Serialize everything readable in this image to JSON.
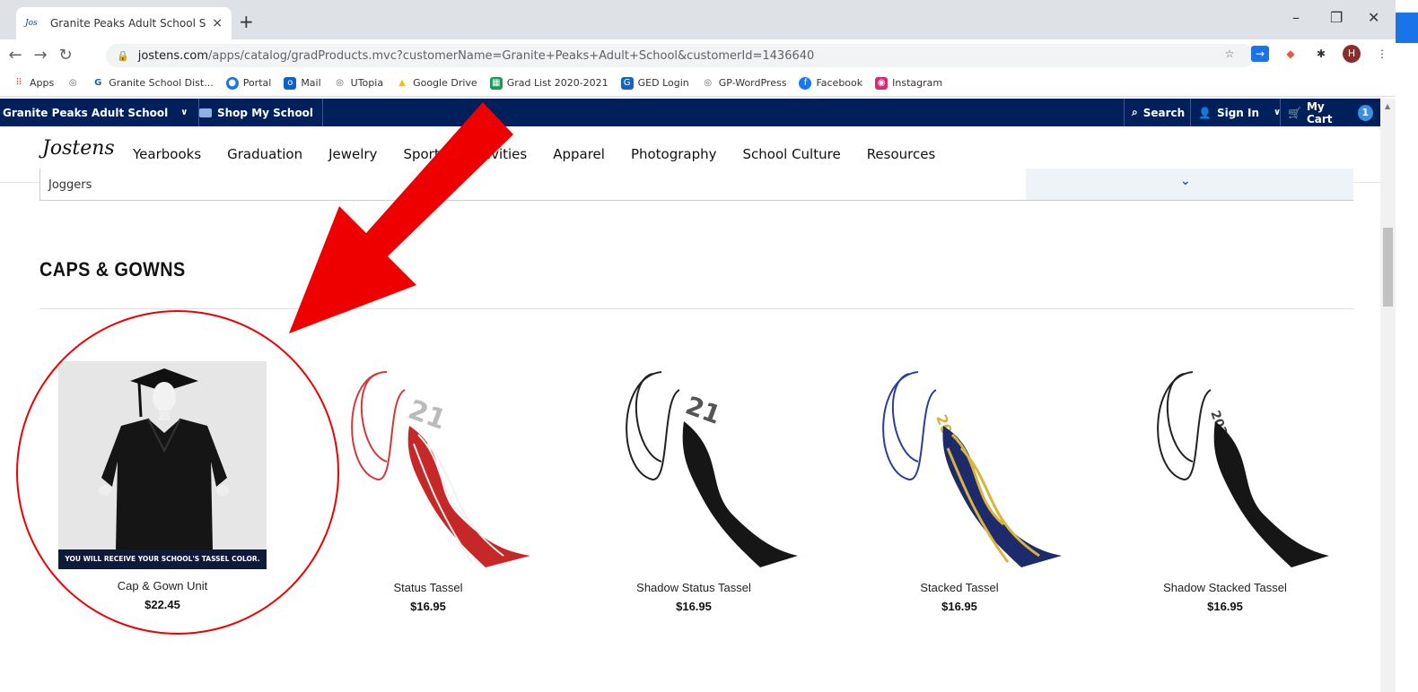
{
  "browser": {
    "tab_title": "Granite Peaks Adult School Salt L",
    "tab_close": "×",
    "new_tab": "+",
    "url_host": "jostens.com",
    "url_path": "/apps/catalog/gradProducts.mvc?customerName=Granite+Peaks+Adult+School&customerId=1436640",
    "avatar_letter": "H",
    "win_min": "–",
    "win_restore": "❐",
    "win_close": "✕"
  },
  "bookmarks": [
    {
      "label": "Apps",
      "icon": "apps-grid-icon",
      "color": "#ea4335"
    },
    {
      "label": "",
      "icon": "globe-icon",
      "color": "#5f6368"
    },
    {
      "label": "Granite School Dist...",
      "icon": "g-icon",
      "color": "#1b5fb5"
    },
    {
      "label": "Portal",
      "icon": "portal-icon",
      "color": "#1a73e8"
    },
    {
      "label": "Mail",
      "icon": "outlook-icon",
      "color": "#0a64c8"
    },
    {
      "label": "UTopia",
      "icon": "globe-icon",
      "color": "#5f6368"
    },
    {
      "label": "Google Drive",
      "icon": "drive-icon",
      "color": "#34a853"
    },
    {
      "label": "Grad List 2020-2021",
      "icon": "sheets-icon",
      "color": "#0f9d58"
    },
    {
      "label": "GED Login",
      "icon": "ged-icon",
      "color": "#1565c0"
    },
    {
      "label": "GP-WordPress",
      "icon": "globe-icon",
      "color": "#5f6368"
    },
    {
      "label": "Facebook",
      "icon": "facebook-icon",
      "color": "#1877f2"
    },
    {
      "label": "Instagram",
      "icon": "instagram-icon",
      "color": "#d62976"
    }
  ],
  "topbar": {
    "school": "Granite Peaks Adult School",
    "shop": "Shop My School",
    "search": "Search",
    "sign_in": "Sign In",
    "cart": "My Cart",
    "cart_count": "1"
  },
  "nav": {
    "logo": "Jostens",
    "items": [
      "Yearbooks",
      "Graduation",
      "Jewelry",
      "Sports & Activities",
      "Apparel",
      "Photography",
      "School Culture",
      "Resources"
    ]
  },
  "filter": {
    "label": "Joggers"
  },
  "section": {
    "title": "CAPS & GOWNS"
  },
  "products": [
    {
      "name": "Cap & Gown Unit",
      "price": "$22.45",
      "banner": "YOU WILL RECEIVE YOUR SCHOOL'S TASSEL COLOR."
    },
    {
      "name": "Status Tassel",
      "price": "$16.95"
    },
    {
      "name": "Shadow Status Tassel",
      "price": "$16.95"
    },
    {
      "name": "Stacked Tassel",
      "price": "$16.95"
    },
    {
      "name": "Shadow Stacked Tassel",
      "price": "$16.95"
    }
  ],
  "colors": {
    "brand_navy": "#00205b",
    "annotation_red": "#e00000"
  }
}
